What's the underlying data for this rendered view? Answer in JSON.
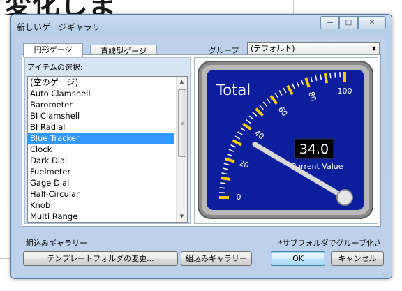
{
  "background": {
    "heading": "変化しま"
  },
  "window": {
    "title": "新しいゲージギャラリー",
    "buttons": {
      "minimize": "—",
      "maximize": "□",
      "close": "✕"
    }
  },
  "tabs": [
    {
      "label": "円形ゲージ",
      "active": true
    },
    {
      "label": "直線型ゲージ",
      "active": false
    }
  ],
  "group": {
    "label": "グループ",
    "selected": "(デフォルト)"
  },
  "items": {
    "label": "アイテムの選択:",
    "list": [
      "(空のゲージ)",
      "Auto Clamshell",
      "Barometer",
      "BI Clamshell",
      "BI Radial",
      "Blue Tracker",
      "Clock",
      "Dark Dial",
      "Fuelmeter",
      "Gage Dial",
      "Half-Circular",
      "Knob",
      "Multi Range"
    ],
    "selected_index": 5
  },
  "gauge": {
    "title": "Total",
    "value": "34.0",
    "value_caption": "Current Value",
    "tick_labels": [
      "0",
      "20",
      "40",
      "60",
      "80",
      "100"
    ],
    "needle_value": 34,
    "colors": {
      "face": "#0b1f9c",
      "accent": "#ffcc00",
      "bezel": "#8c8c8c"
    }
  },
  "footer": {
    "builtin_label": "組込みギャラリー",
    "note": "*サブフォルダでグループ化されます。",
    "template_button": "テンプレートフォルダの変更...",
    "builtin_button": "組込みギャラリー",
    "ok_button": "OK",
    "cancel_button": "キャンセル"
  }
}
